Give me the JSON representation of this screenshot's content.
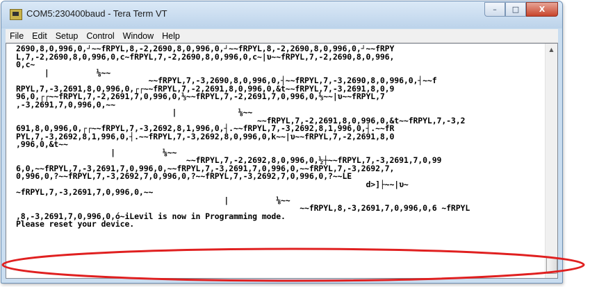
{
  "window": {
    "title": "COM5:230400baud - Tera Term VT",
    "caption_buttons": [
      "–",
      "□",
      "X"
    ]
  },
  "menu": [
    "File",
    "Edit",
    "Setup",
    "Control",
    "Window",
    "Help"
  ],
  "terminal": {
    "lines": [
      "2690,8,0,996,0,┘~~fRPYL,8,-2,2690,8,0,996,0,┘~~fRPYL,8,-2,2690,8,0,996,0,┘~~fRPY",
      "L,7,-2,2690,8,0,996,0,c~fRPYL,7,-2,2690,8,0,996,0,c~|υ~~fRPYL,7,-2,2690,8,0,996,",
      "0,c~",
      "      |          ⅛~~",
      "                            ~~fRPYL,7,-3,2690,8,0,996,0,┤~~fRPYL,7,-3,2690,8,0,996,0,┤~~f",
      "RPYL,7,-3,2691,8,0,996,0,┌┌~~fRPYL,7,-2,2691,8,0,996,0,&t~~fRPYL,7,-3,2691,8,0,9",
      "96,0,┌┌~~fRPYL,7,-2,2691,7,0,996,0,⅓~~fRPYL,7,-2,2691,7,0,996,0,⅓~~|υ~~fRPYL,7",
      ",-3,2691,7,0,996,0,~~",
      "                                 |             ⅛~~",
      "                                                   ~~fRPYL,7,-2,2691,8,0,996,0,&t~~fRPYL,7,-3,2",
      "691,8,0,996,0,┌┌~~fRPYL,7,-3,2692,8,1,996,0,┤.~~fRPYL,7,-3,2692,8,1,996,0,┤.~~fR",
      "PYL,7,-3,2692,8,1,996,0,┤.~~fRPYL,7,-3,2692,8,0,996,0,k~~|υ~~fRPYL,7,-2,2691,8,0",
      ",996,0,&t~~",
      "                    |          ⅛~~",
      "                                    ~~fRPYL,7,-2,2692,8,0,996,0,½┼~~fRPYL,7,-3,2691,7,0,99",
      "6,0,~~fRPYL,7,-3,2691,7,0,996,0,~~fRPYL,7,-3,2691,7,0,996,0,~~fRPYL,7,-3,2692,7,",
      "0,996,0,?~~fRPYL,7,-3,2692,7,0,996,0,?~~fRPYL,7,-3,2692,7,0,996,0,?~~LE",
      "                                                                          d>]├~~|υ~",
      "~fRPYL,7,-3,2691,7,0,996,0,~~",
      "                                            |          ⅛~~",
      "                                                            ~~fRPYL,8,-3,2691,7,0,996,0,6 ~fRPYL",
      ",8,-3,2691,7,0,996,0,ó~iLevil is now in Programming mode.",
      "Please reset your device."
    ]
  },
  "colors": {
    "title_bar": "#c9ddf0",
    "close_button": "#c8452c",
    "terminal_bg": "#ffffff",
    "annotation": "#e02020"
  }
}
